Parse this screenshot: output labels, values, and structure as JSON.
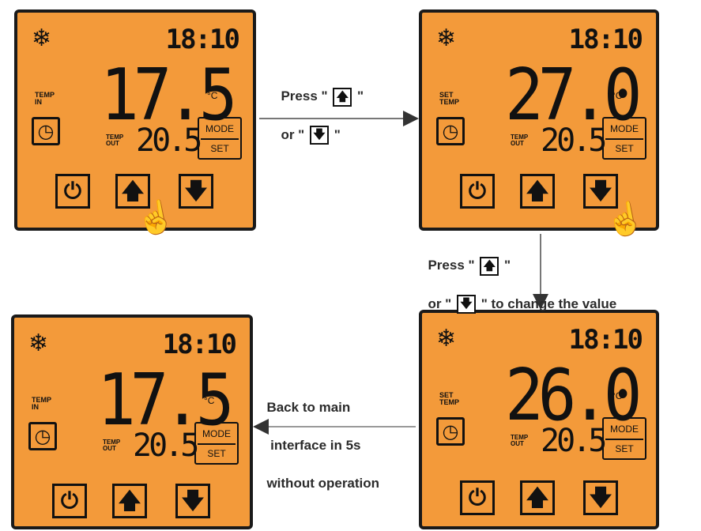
{
  "panels": [
    {
      "id": "p1",
      "snow": "❄",
      "clock": "18:10",
      "mainlabel": "TEMP IN",
      "bignum": "17.5",
      "unit": "°C",
      "outlabel": "TEMP OUT",
      "outnum": "20.5",
      "mode": "MODE",
      "set": "SET",
      "power": "⏻",
      "up": "🡅",
      "down": "🡇"
    },
    {
      "id": "p2",
      "snow": "❄",
      "clock": "18:10",
      "mainlabel": "SET TEMP",
      "bignum": "27.0",
      "unit": "°C",
      "outlabel": "TEMP OUT",
      "outnum": "20.5",
      "mode": "MODE",
      "set": "SET",
      "power": "⏻",
      "up": "🡅",
      "down": "🡇"
    },
    {
      "id": "p3",
      "snow": "❄",
      "clock": "18:10",
      "mainlabel": "TEMP IN",
      "bignum": "17.5",
      "unit": "°C",
      "outlabel": "TEMP OUT",
      "outnum": "20.5",
      "mode": "MODE",
      "set": "SET",
      "power": "⏻",
      "up": "🡅",
      "down": "🡇"
    },
    {
      "id": "p4",
      "snow": "❄",
      "clock": "18:10",
      "mainlabel": "SET TEMP",
      "bignum": "26.0",
      "unit": "°C",
      "outlabel": "TEMP OUT",
      "outnum": "20.5",
      "mode": "MODE",
      "set": "SET",
      "power": "⏻",
      "up": "🡅",
      "down": "🡇"
    }
  ],
  "captions": {
    "press1_line1": "Press",
    "press1_or": "or",
    "press2_line1": "Press",
    "press2_line2_or": "or",
    "press2_line2_rest": "to change the value",
    "back_line1": "Back to main",
    "back_line2": " interface in 5s",
    "back_line3": "without operation"
  },
  "colors": {
    "panel": "#f39a3a",
    "border": "#1a1a1a",
    "arrow": "#555555"
  }
}
